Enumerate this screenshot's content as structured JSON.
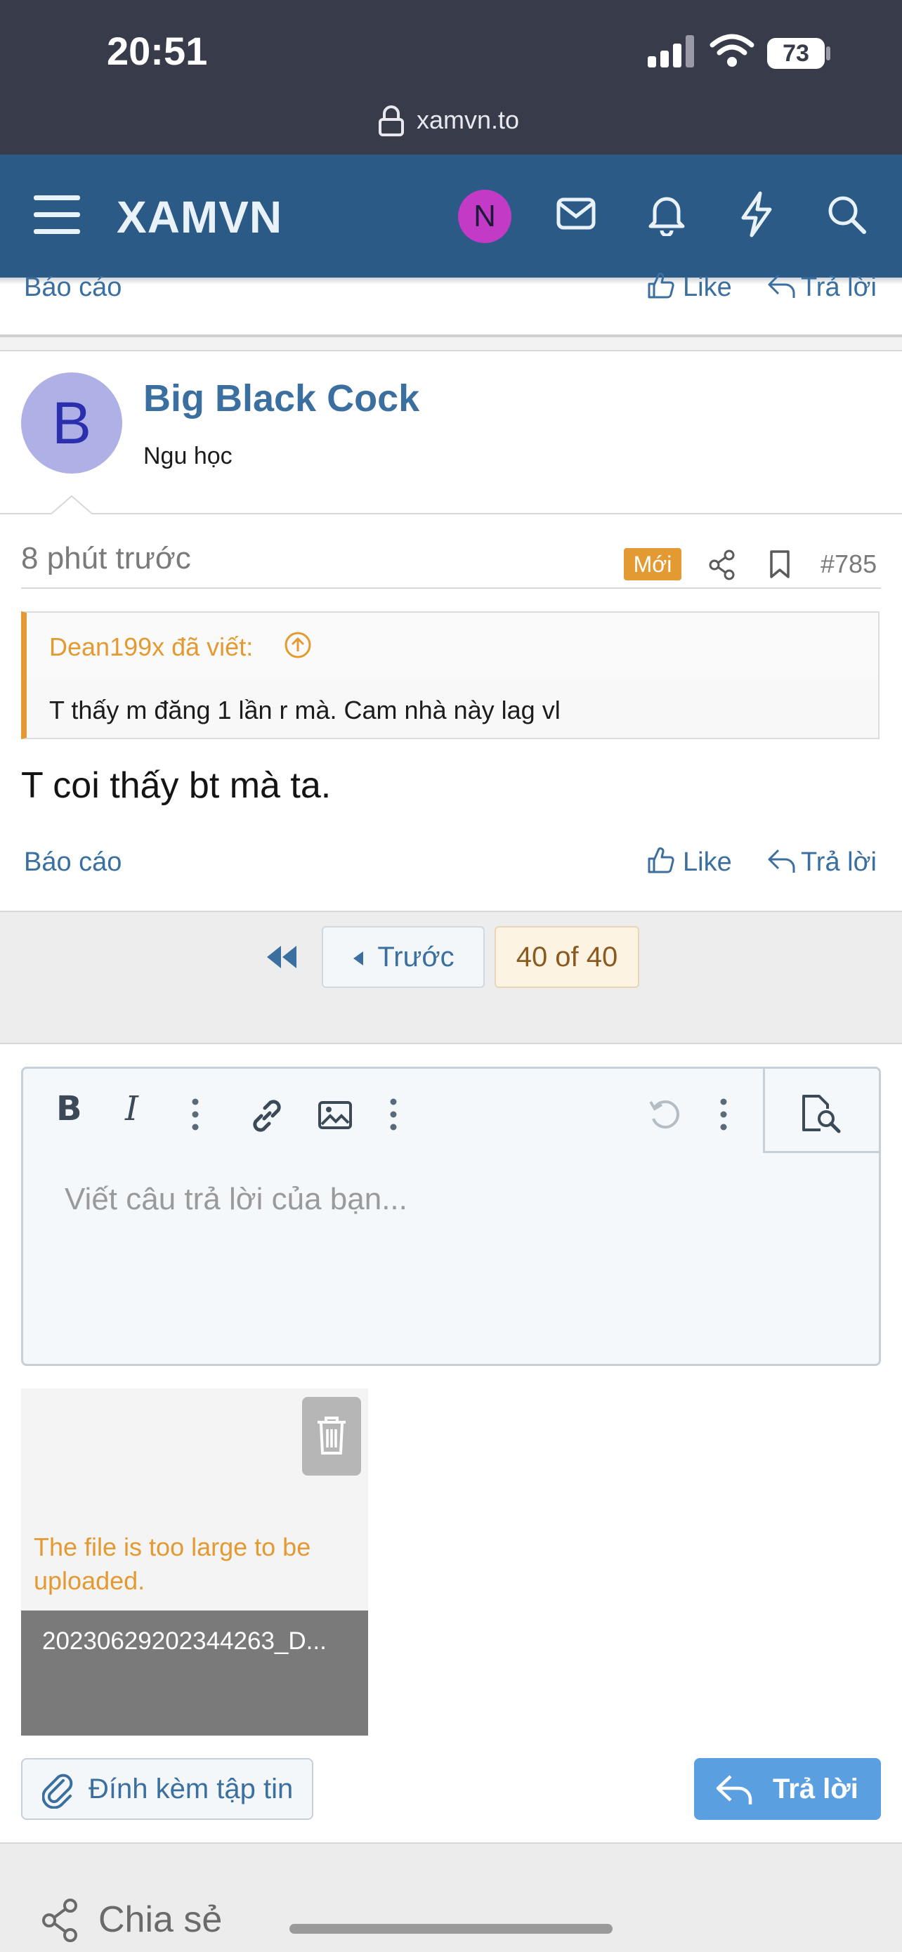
{
  "status_bar": {
    "time": "20:51",
    "battery": "73"
  },
  "browser": {
    "url": "xamvn.to"
  },
  "header": {
    "logo": "XAMVN",
    "avatar_initial": "N"
  },
  "prev_post_actions": {
    "report": "Báo cáo",
    "like": "Like",
    "reply": "Trả lời"
  },
  "post": {
    "avatar_initial": "B",
    "username": "Big Black Cock",
    "user_title": "Ngu học",
    "time_ago": "8 phút trước",
    "badge_new": "Mới",
    "post_number": "#785",
    "quote_author": "Dean199x đã viết:",
    "quote_text": "T thấy m đăng 1 lần r mà. Cam nhà này lag vl",
    "text": "T coi thấy bt mà ta.",
    "report": "Báo cáo",
    "like": "Like",
    "reply": "Trả lời"
  },
  "pagination": {
    "prev_label": "Trước",
    "current": "40 of 40"
  },
  "editor": {
    "placeholder": "Viết câu trả lời của bạn..."
  },
  "attachment": {
    "error": "The file is too large to be uploaded.",
    "filename": "20230629202344263_D..."
  },
  "actions": {
    "attach_label": "Đính kèm tập tin",
    "reply_label": "Trả lời"
  },
  "footer": {
    "share_label": "Chia sẻ"
  },
  "colors": {
    "header_bg": "#2b5a86",
    "accent_orange": "#e49a32",
    "link_blue": "#3a6f9f",
    "reply_button": "#5aa0e0"
  }
}
